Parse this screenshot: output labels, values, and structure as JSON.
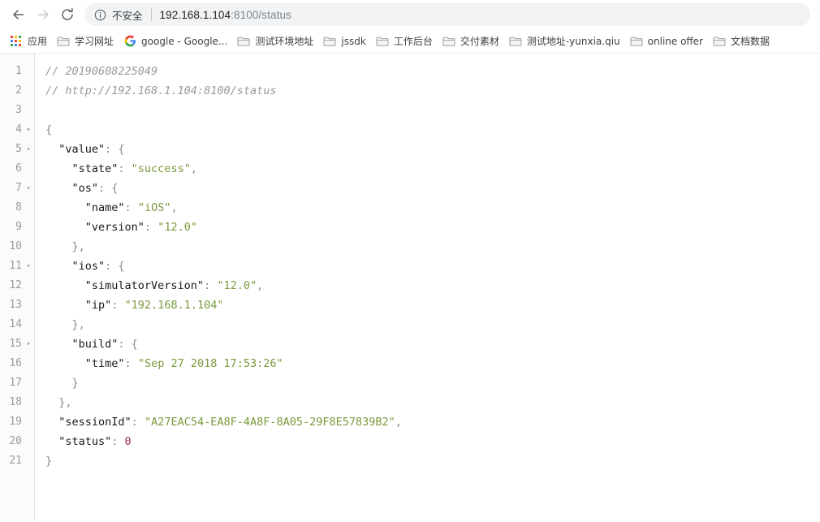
{
  "browser": {
    "nav": {
      "back_icon": "arrow-left-icon",
      "forward_icon": "arrow-right-icon",
      "reload_icon": "reload-icon"
    },
    "omnibox": {
      "info_icon": "info-circle-icon",
      "security_label": "不安全",
      "url_host": "192.168.1.104",
      "url_rest": ":8100/status",
      "full_url": "192.168.1.104:8100/status"
    },
    "bookmarks": [
      {
        "label": "应用",
        "icon": "apps-grid-icon"
      },
      {
        "label": "学习网址",
        "icon": "folder-icon"
      },
      {
        "label": "google - Google...",
        "icon": "google-g-icon"
      },
      {
        "label": "测试环境地址",
        "icon": "folder-icon"
      },
      {
        "label": "jssdk",
        "icon": "folder-icon"
      },
      {
        "label": "工作后台",
        "icon": "folder-icon"
      },
      {
        "label": "交付素材",
        "icon": "folder-icon"
      },
      {
        "label": "测试地址-yunxia.qiu",
        "icon": "folder-icon"
      },
      {
        "label": "online offer",
        "icon": "folder-icon"
      },
      {
        "label": "文档数据",
        "icon": "folder-icon"
      }
    ]
  },
  "viewer": {
    "lines": [
      {
        "n": "1",
        "fold": "",
        "tokens": [
          {
            "t": "comment",
            "v": "// 20190608225049"
          }
        ]
      },
      {
        "n": "2",
        "fold": "",
        "tokens": [
          {
            "t": "comment",
            "v": "// http://192.168.1.104:8100/status"
          }
        ]
      },
      {
        "n": "3",
        "fold": "",
        "tokens": []
      },
      {
        "n": "4",
        "fold": "▾",
        "tokens": [
          {
            "t": "punct",
            "v": "{"
          }
        ]
      },
      {
        "n": "5",
        "fold": "▾",
        "tokens": [
          {
            "t": "key",
            "v": "  \"value\""
          },
          {
            "t": "colon",
            "v": ": "
          },
          {
            "t": "punct",
            "v": "{"
          }
        ]
      },
      {
        "n": "6",
        "fold": "",
        "tokens": [
          {
            "t": "key",
            "v": "    \"state\""
          },
          {
            "t": "colon",
            "v": ": "
          },
          {
            "t": "string",
            "v": "\"success\""
          },
          {
            "t": "punct",
            "v": ","
          }
        ]
      },
      {
        "n": "7",
        "fold": "▾",
        "tokens": [
          {
            "t": "key",
            "v": "    \"os\""
          },
          {
            "t": "colon",
            "v": ": "
          },
          {
            "t": "punct",
            "v": "{"
          }
        ]
      },
      {
        "n": "8",
        "fold": "",
        "tokens": [
          {
            "t": "key",
            "v": "      \"name\""
          },
          {
            "t": "colon",
            "v": ": "
          },
          {
            "t": "string",
            "v": "\"iOS\""
          },
          {
            "t": "punct",
            "v": ","
          }
        ]
      },
      {
        "n": "9",
        "fold": "",
        "tokens": [
          {
            "t": "key",
            "v": "      \"version\""
          },
          {
            "t": "colon",
            "v": ": "
          },
          {
            "t": "string",
            "v": "\"12.0\""
          }
        ]
      },
      {
        "n": "10",
        "fold": "",
        "tokens": [
          {
            "t": "punct",
            "v": "    },"
          }
        ]
      },
      {
        "n": "11",
        "fold": "▾",
        "tokens": [
          {
            "t": "key",
            "v": "    \"ios\""
          },
          {
            "t": "colon",
            "v": ": "
          },
          {
            "t": "punct",
            "v": "{"
          }
        ]
      },
      {
        "n": "12",
        "fold": "",
        "tokens": [
          {
            "t": "key",
            "v": "      \"simulatorVersion\""
          },
          {
            "t": "colon",
            "v": ": "
          },
          {
            "t": "string",
            "v": "\"12.0\""
          },
          {
            "t": "punct",
            "v": ","
          }
        ]
      },
      {
        "n": "13",
        "fold": "",
        "tokens": [
          {
            "t": "key",
            "v": "      \"ip\""
          },
          {
            "t": "colon",
            "v": ": "
          },
          {
            "t": "string",
            "v": "\"192.168.1.104\""
          }
        ]
      },
      {
        "n": "14",
        "fold": "",
        "tokens": [
          {
            "t": "punct",
            "v": "    },"
          }
        ]
      },
      {
        "n": "15",
        "fold": "▾",
        "tokens": [
          {
            "t": "key",
            "v": "    \"build\""
          },
          {
            "t": "colon",
            "v": ": "
          },
          {
            "t": "punct",
            "v": "{"
          }
        ]
      },
      {
        "n": "16",
        "fold": "",
        "tokens": [
          {
            "t": "key",
            "v": "      \"time\""
          },
          {
            "t": "colon",
            "v": ": "
          },
          {
            "t": "string",
            "v": "\"Sep 27 2018 17:53:26\""
          }
        ]
      },
      {
        "n": "17",
        "fold": "",
        "tokens": [
          {
            "t": "punct",
            "v": "    }"
          }
        ]
      },
      {
        "n": "18",
        "fold": "",
        "tokens": [
          {
            "t": "punct",
            "v": "  },"
          }
        ]
      },
      {
        "n": "19",
        "fold": "",
        "tokens": [
          {
            "t": "key",
            "v": "  \"sessionId\""
          },
          {
            "t": "colon",
            "v": ": "
          },
          {
            "t": "string",
            "v": "\"A27EAC54-EA8F-4A8F-8A05-29F8E57839B2\""
          },
          {
            "t": "punct",
            "v": ","
          }
        ]
      },
      {
        "n": "20",
        "fold": "",
        "tokens": [
          {
            "t": "key",
            "v": "  \"status\""
          },
          {
            "t": "colon",
            "v": ": "
          },
          {
            "t": "number",
            "v": "0"
          }
        ]
      },
      {
        "n": "21",
        "fold": "",
        "tokens": [
          {
            "t": "punct",
            "v": "}"
          }
        ]
      }
    ]
  },
  "colors": {
    "string_green": "#7a9a3c",
    "number_red": "#9c2d4a",
    "key_dark": "#1a1a1a",
    "comment_gray": "#9a9a9a",
    "omnibox_bg": "#f1f3f4"
  }
}
